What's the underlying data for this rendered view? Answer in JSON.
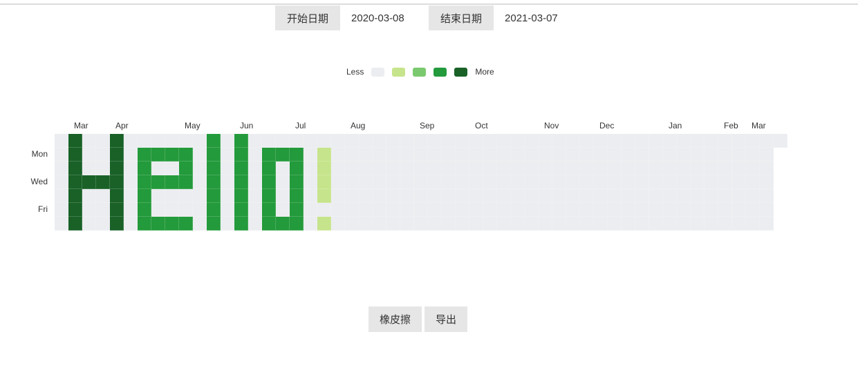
{
  "date_range": {
    "start_label": "开始日期",
    "start_value": "2020-03-08",
    "end_label": "结束日期",
    "end_value": "2021-03-07"
  },
  "legend": {
    "less": "Less",
    "more": "More",
    "levels": [
      "#ebedf0",
      "#c6e48b",
      "#7bc96f",
      "#239a3b",
      "#196127"
    ]
  },
  "calendar": {
    "months": [
      "Mar",
      "Apr",
      "May",
      "Jun",
      "Jul",
      "Aug",
      "Sep",
      "Oct",
      "Nov",
      "Dec",
      "Jan",
      "Feb",
      "Mar"
    ],
    "month_week_index": [
      2,
      5,
      10,
      14,
      18,
      22,
      27,
      31,
      36,
      40,
      45,
      49,
      51
    ],
    "weekdays": [
      "Mon",
      "Wed",
      "Fri"
    ],
    "weekday_rows": [
      1,
      3,
      5
    ],
    "weeks": 53,
    "last_week_days": 1,
    "drawing": {
      "1": [
        4,
        4,
        4,
        4,
        4,
        4,
        4
      ],
      "2": [
        0,
        0,
        0,
        4,
        0,
        0,
        0
      ],
      "3": [
        0,
        0,
        0,
        4,
        0,
        0,
        0
      ],
      "4": [
        4,
        4,
        4,
        4,
        4,
        4,
        4
      ],
      "6": [
        0,
        3,
        3,
        3,
        3,
        3,
        3
      ],
      "7": [
        0,
        3,
        0,
        3,
        0,
        0,
        3
      ],
      "8": [
        0,
        3,
        0,
        3,
        0,
        0,
        3
      ],
      "9": [
        0,
        3,
        3,
        3,
        0,
        0,
        3
      ],
      "11": [
        3,
        3,
        3,
        3,
        3,
        3,
        3
      ],
      "13": [
        3,
        3,
        3,
        3,
        3,
        3,
        3
      ],
      "15": [
        0,
        3,
        3,
        3,
        3,
        3,
        3
      ],
      "16": [
        0,
        3,
        0,
        0,
        0,
        0,
        3
      ],
      "17": [
        0,
        3,
        3,
        3,
        3,
        3,
        3
      ],
      "19": [
        0,
        1,
        1,
        1,
        1,
        0,
        1
      ]
    }
  },
  "actions": {
    "eraser": "橡皮擦",
    "export": "导出"
  }
}
